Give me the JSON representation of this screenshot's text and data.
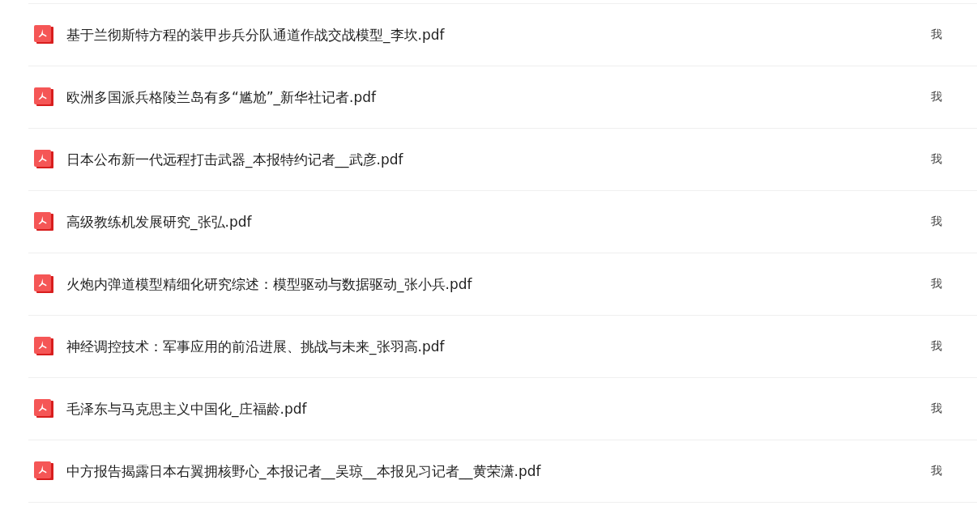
{
  "files": [
    {
      "name": "基于兰彻斯特方程的装甲步兵分队通道作战交战模型_李坎.pdf",
      "owner": "我"
    },
    {
      "name": "欧洲多国派兵格陵兰岛有多“尴尬”_新华社记者.pdf",
      "owner": "我"
    },
    {
      "name": "日本公布新一代远程打击武器_本报特约记者__武彦.pdf",
      "owner": "我"
    },
    {
      "name": "高级教练机发展研究_张弘.pdf",
      "owner": "我"
    },
    {
      "name": "火炮内弹道模型精细化研究综述：模型驱动与数据驱动_张小兵.pdf",
      "owner": "我"
    },
    {
      "name": "神经调控技术：军事应用的前沿进展、挑战与未来_张羽高.pdf",
      "owner": "我"
    },
    {
      "name": "毛泽东与马克思主义中国化_庄福龄.pdf",
      "owner": "我"
    },
    {
      "name": "中方报告揭露日本右翼拥核野心_本报记者__吴琼__本报见习记者__黄荣潇.pdf",
      "owner": "我"
    }
  ]
}
